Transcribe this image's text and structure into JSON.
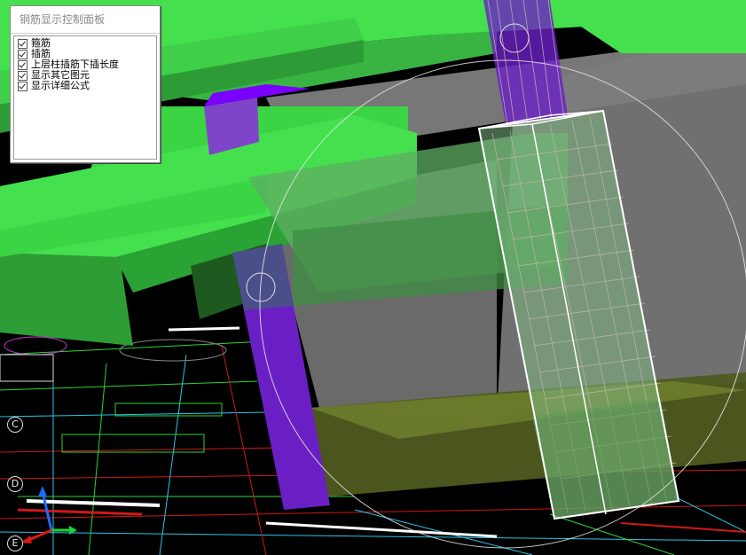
{
  "panel": {
    "title": "钢筋显示控制面板",
    "options": [
      {
        "label": "箍筋",
        "checked": true
      },
      {
        "label": "插筋",
        "checked": true
      },
      {
        "label": "上层柱插筋下插长度",
        "checked": true
      },
      {
        "label": "显示其它图元",
        "checked": true
      },
      {
        "label": "显示详细公式",
        "checked": true
      }
    ]
  },
  "axis_markers": [
    {
      "label": "C"
    },
    {
      "label": "D"
    },
    {
      "label": "E"
    }
  ],
  "colors": {
    "slab_green": "#3fd84a",
    "beam_dark_green": "#2a9a34",
    "column_purple": "#6a1fc4",
    "glass_gray": "#9a9a9a",
    "cad_background": "#000000",
    "rebar_lines": "#c8b7aa"
  },
  "icons": {
    "gizmo": "orbit-circle-icon",
    "axes": "xyz-axis-icon"
  }
}
